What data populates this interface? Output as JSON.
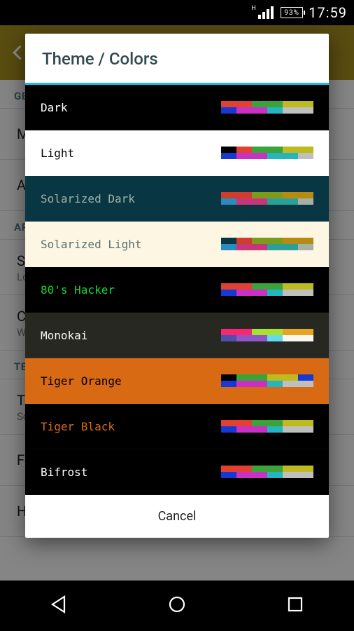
{
  "status_bar": {
    "signal_label": "H",
    "battery_pct": "93%",
    "clock": "17:59"
  },
  "bg_app": {
    "sections": [
      {
        "header": "GENERAL",
        "rows": [
          {
            "title": "Message Notification",
            "sub": ""
          },
          {
            "title": "Away Notification",
            "sub": ""
          }
        ]
      },
      {
        "header": "APPEARANCE",
        "rows": [
          {
            "title": "Sound",
            "sub": "Long"
          },
          {
            "title": "Color",
            "sub": "White"
          }
        ]
      },
      {
        "header": "TEXT",
        "rows": [
          {
            "title": "Theme",
            "sub": "Solarized Light"
          },
          {
            "title": "Font",
            "sub": ""
          },
          {
            "title": "Horizontal Swipe",
            "sub": ""
          }
        ]
      }
    ]
  },
  "dialog": {
    "title": "Theme / Colors",
    "cancel": "Cancel",
    "themes": [
      {
        "name": "Dark",
        "bg": "#000000",
        "fg": "#ffffff",
        "rows": [
          [
            "#e14132",
            "#e14132",
            "#3aa33a",
            "#3aa33a",
            "#bdbb1e",
            "#bdbb1e"
          ],
          [
            "#1838d4",
            "#c930c3",
            "#c930c3",
            "#25b5be",
            "#bfbfbf",
            "#bfbfbf"
          ]
        ]
      },
      {
        "name": "Light",
        "bg": "#ffffff",
        "fg": "#000000",
        "rows": [
          [
            "#000000",
            "#e14132",
            "#3aa33a",
            "#3aa33a",
            "#bdbb1e",
            "#bdbb1e"
          ],
          [
            "#1838d4",
            "#c930c3",
            "#c930c3",
            "#25b5be",
            "#25b5be",
            "#bfbfbf"
          ]
        ]
      },
      {
        "name": "Solarized Dark",
        "bg": "#083642",
        "fg": "#a6b0a5",
        "rows": [
          [
            "#cf3d2e",
            "#cf3d2e",
            "#7c9a1b",
            "#7c9a1b",
            "#b58b13",
            "#b58b13"
          ],
          [
            "#2a8bbf",
            "#c9357a",
            "#c9357a",
            "#2aa198",
            "#2aa198",
            "#a6b0a5"
          ]
        ]
      },
      {
        "name": "Solarized Light",
        "bg": "#fdf6e3",
        "fg": "#5b6e74",
        "rows": [
          [
            "#083642",
            "#cf3d2e",
            "#7c9a1b",
            "#7c9a1b",
            "#b58b13",
            "#b58b13"
          ],
          [
            "#2a8bbf",
            "#c9357a",
            "#c9357a",
            "#2aa198",
            "#2aa198",
            "#a6b0a5"
          ]
        ]
      },
      {
        "name": "80's Hacker",
        "bg": "#000000",
        "fg": "#18d43a",
        "rows": [
          [
            "#e14132",
            "#e14132",
            "#3aa33a",
            "#3aa33a",
            "#bdbb1e",
            "#bdbb1e"
          ],
          [
            "#1838d4",
            "#c930c3",
            "#c930c3",
            "#25b5be",
            "#bfbfbf",
            "#bfbfbf"
          ]
        ]
      },
      {
        "name": "Monokai",
        "bg": "#272822",
        "fg": "#f8f8f2",
        "rows": [
          [
            "#f92672",
            "#f92672",
            "#a6e22e",
            "#a6e22e",
            "#e6a420",
            "#e6a420"
          ],
          [
            "#5050a8",
            "#9055c7",
            "#9055c7",
            "#66d9ef",
            "#f8f8f2",
            "#f8f8f2"
          ]
        ]
      },
      {
        "name": "Tiger Orange",
        "bg": "#d86a14",
        "fg": "#000000",
        "rows": [
          [
            "#000000",
            "#3aa33a",
            "#3aa33a",
            "#bdbb1e",
            "#bdbb1e",
            "#1838d4"
          ],
          [
            "#1838d4",
            "#c930c3",
            "#c930c3",
            "#25b5be",
            "#bfbfbf",
            "#bfbfbf"
          ]
        ]
      },
      {
        "name": "Tiger Black",
        "bg": "#000000",
        "fg": "#d86a14",
        "rows": [
          [
            "#e14132",
            "#e14132",
            "#3aa33a",
            "#3aa33a",
            "#bdbb1e",
            "#bdbb1e"
          ],
          [
            "#1838d4",
            "#c930c3",
            "#c930c3",
            "#25b5be",
            "#bfbfbf",
            "#bfbfbf"
          ]
        ]
      },
      {
        "name": "Bifrost",
        "bg": "#000000",
        "fg": "#ffffff",
        "rows": [
          [
            "#e14132",
            "#e14132",
            "#3aa33a",
            "#3aa33a",
            "#bdbb1e",
            "#bdbb1e"
          ],
          [
            "#1838d4",
            "#c930c3",
            "#c930c3",
            "#25b5be",
            "#bfbfbf",
            "#bfbfbf"
          ]
        ]
      }
    ]
  }
}
